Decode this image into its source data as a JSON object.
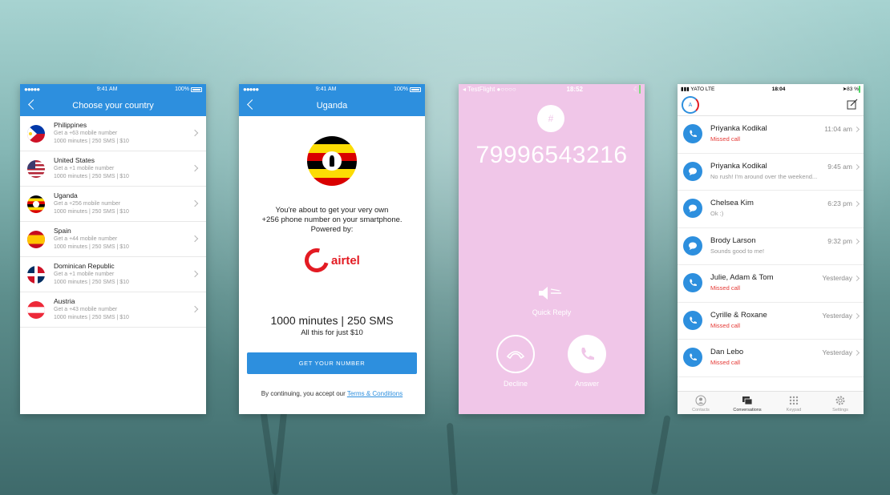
{
  "phone1": {
    "status": {
      "time": "9:41 AM",
      "battery": "100%"
    },
    "title": "Choose your country",
    "countries": [
      {
        "name": "Philippines",
        "sub": "Get a +63 mobile number",
        "plan": "1000 minutes  |  250 SMS  |  $10"
      },
      {
        "name": "United States",
        "sub": "Get a +1 mobile number",
        "plan": "1000 minutes  |  250 SMS  |  $10"
      },
      {
        "name": "Uganda",
        "sub": "Get a +256 mobile number",
        "plan": "1000 minutes  |  250 SMS  |  $10"
      },
      {
        "name": "Spain",
        "sub": "Get a +44 mobile number",
        "plan": "1000 minutes  |  250 SMS  |  $10"
      },
      {
        "name": "Dominican Republic",
        "sub": "Get a +1 mobile number",
        "plan": "1000 minutes  |  250 SMS  |  $10"
      },
      {
        "name": "Austria",
        "sub": "Get a +43 mobile number",
        "plan": "1000 minutes  |  250 SMS  |  $10"
      }
    ]
  },
  "phone2": {
    "status": {
      "time": "9:41 AM",
      "battery": "100%"
    },
    "title": "Uganda",
    "intro_line1": "You're about to get your very own",
    "intro_line2": "+256 phone number on your smartphone.",
    "intro_line3": "Powered by:",
    "brand": "airtel",
    "plan": "1000 minutes | 250 SMS",
    "price": "All this for just $10",
    "cta": "GET YOUR NUMBER",
    "terms_prefix": "By continuing, you accept our ",
    "terms_link": "Terms & Conditions"
  },
  "phone3": {
    "status": {
      "carrier": "TestFlight",
      "time": "18:52"
    },
    "hash": "#",
    "number": "79996543216",
    "quick_reply": "Quick Reply",
    "decline": "Decline",
    "answer": "Answer"
  },
  "phone4": {
    "status": {
      "carrier": "YATO",
      "network": "LTE",
      "time": "18:04",
      "battery": "83 %"
    },
    "logo": "A",
    "conversations": [
      {
        "name": "Priyanka Kodikal",
        "sub": "Missed call",
        "time": "11:04 am",
        "kind": "call"
      },
      {
        "name": "Priyanka Kodikal",
        "sub": "No rush! I'm around over the weekend...",
        "time": "9:45 am",
        "kind": "message"
      },
      {
        "name": "Chelsea Kim",
        "sub": "Ok :)",
        "time": "6:23 pm",
        "kind": "message"
      },
      {
        "name": "Brody Larson",
        "sub": "Sounds good to me!",
        "time": "9:32 pm",
        "kind": "message"
      },
      {
        "name": "Julie, Adam & Tom",
        "sub": "Missed call",
        "time": "Yesterday",
        "kind": "call"
      },
      {
        "name": "Cyrille & Roxane",
        "sub": "Missed call",
        "time": "Yesterday",
        "kind": "call"
      },
      {
        "name": "Dan Lebo",
        "sub": "Missed call",
        "time": "Yesterday",
        "kind": "call"
      }
    ],
    "tabs": [
      "Contacts",
      "Conversations",
      "Keypad",
      "Settings"
    ],
    "active_tab": "Conversations"
  },
  "colors": {
    "accent_blue": "#2d8fde",
    "missed_red": "#e53935",
    "call_bg_pink": "#f0c6e8",
    "airtel_red": "#e31b23"
  }
}
